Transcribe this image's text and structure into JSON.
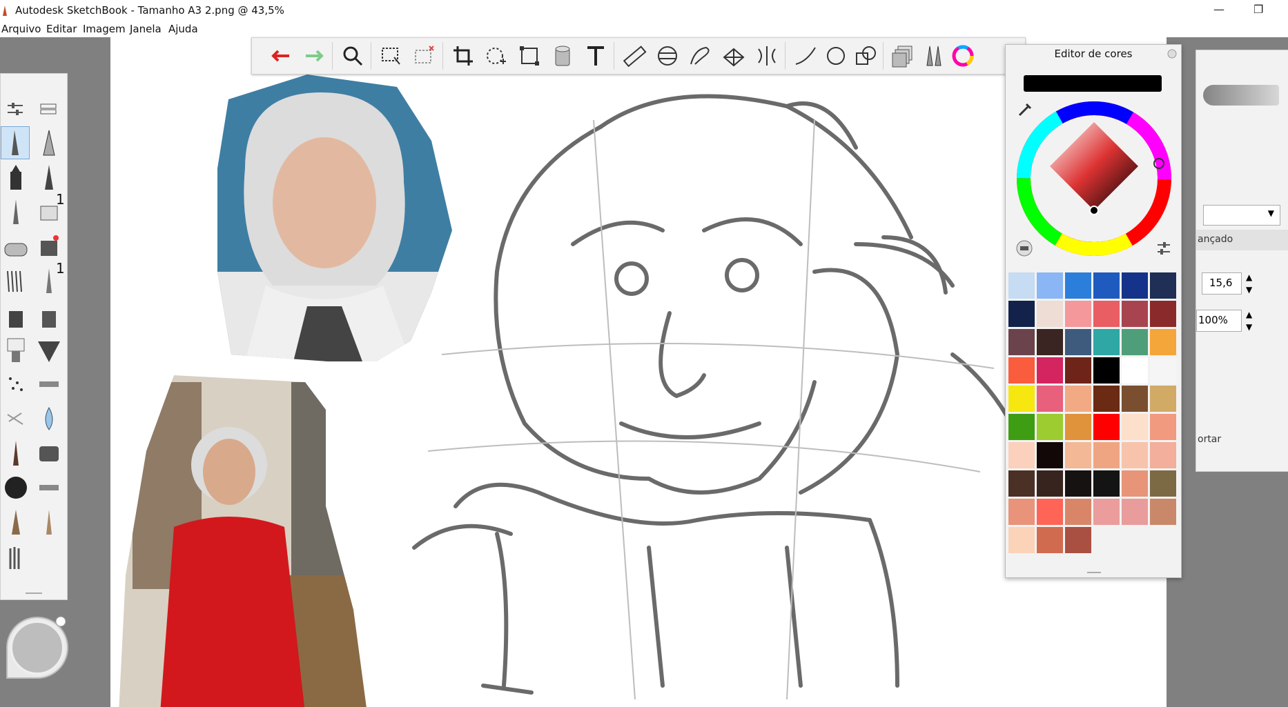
{
  "window": {
    "title": "Autodesk SketchBook - Tamanho A3 2.png @ 43,5%"
  },
  "menu": [
    "Arquivo",
    "Editar",
    "Imagem",
    "Janela",
    "Ajuda"
  ],
  "tools": {
    "brush_count_1": "1",
    "brush_count_2": "1"
  },
  "right_panel": {
    "size_value": "15,6",
    "opacity_value": "100%",
    "section_label": "ançado",
    "export_label": "ortar"
  },
  "color_editor": {
    "title": "Editor de cores",
    "current_color": "#000000",
    "swatches": [
      "#c5dcf2",
      "#8ab6f5",
      "#2b7fdb",
      "#1f5bbf",
      "#15338a",
      "#1f2f55",
      "#13224a",
      "#eeddd4",
      "#f5989b",
      "#e85e63",
      "#a84450",
      "#8b2a2a",
      "#6b434c",
      "#3a2522",
      "#3e5a7d",
      "#2ea7a5",
      "#4f9e7a",
      "#f4a63a",
      "#fa5c3e",
      "#d42560",
      "#6e2418",
      "#000000",
      "#ffffff",
      "#f5f5f5",
      "#f5e70f",
      "#e9607c",
      "#f2aa84",
      "#6a2a14",
      "#7a4f30",
      "#d1aa66",
      "#3f9d14",
      "#9ccc30",
      "#e0933b",
      "#ff0000",
      "#fde0cc",
      "#f19a80",
      "#fbd0bc",
      "#120808",
      "#f3b895",
      "#f0a582",
      "#f7c4ab",
      "#f3ae9c",
      "#4a3025",
      "#38241f",
      "#151211",
      "#141414",
      "#e89478",
      "#7b6a44",
      "#e9937a",
      "#fe6556",
      "#d98668",
      "#eb9c9c",
      "#e99c9c",
      "#c98869",
      "#fbd3b9",
      "#d16b50",
      "#a95042"
    ]
  }
}
